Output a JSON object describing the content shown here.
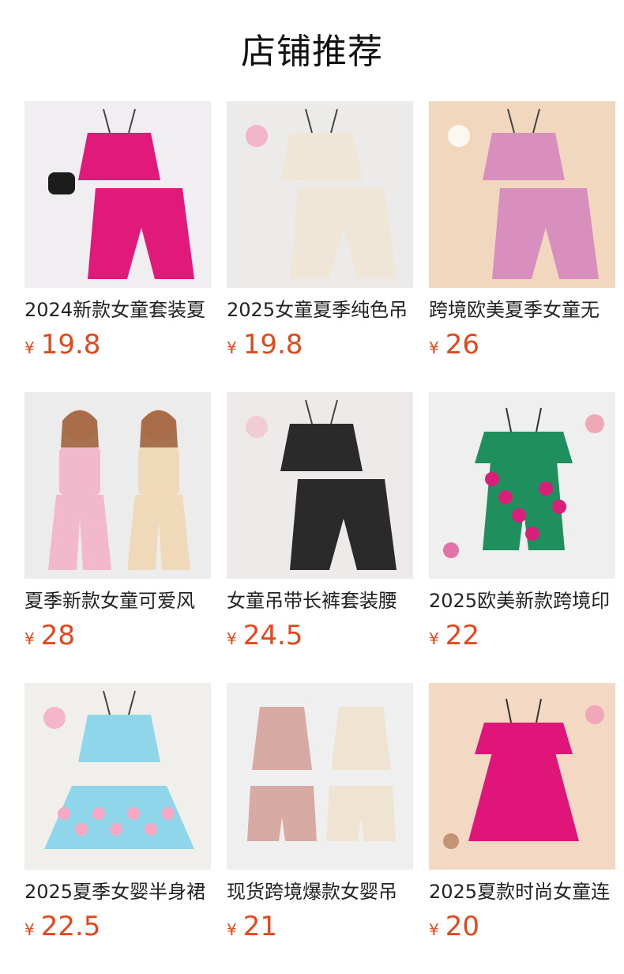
{
  "section": {
    "title": "店铺推荐",
    "currency_symbol": "¥",
    "price_color": "#e4471a"
  },
  "products": [
    {
      "name": "2024新款女童套装夏",
      "price": "19.8",
      "image_icon": "pink-halter-top-and-pants-set-image",
      "bg": "#f1eef2",
      "main": "#e0197a",
      "accent": "#1c1c1c"
    },
    {
      "name": "2025女童夏季纯色吊",
      "price": "19.8",
      "image_icon": "cream-ruffle-cami-and-pants-set-image",
      "bg": "#ecebea",
      "main": "#efe6d8",
      "accent": "#f2a7c3"
    },
    {
      "name": "跨境欧美夏季女童无",
      "price": "26",
      "image_icon": "pink-print-tank-and-pants-set-image",
      "bg": "#f2d7bf",
      "main": "#d98fbe",
      "accent": "#ffffff"
    },
    {
      "name": "夏季新款女童可爱风",
      "price": "28",
      "image_icon": "two-girls-smocked-set-photo-image",
      "bg": "#ececec",
      "main": "#f2b9cc",
      "accent": "#efd9b8"
    },
    {
      "name": "女童吊带长裤套装腰",
      "price": "24.5",
      "image_icon": "black-paisley-cami-and-pants-set-image",
      "bg": "#efeaea",
      "main": "#2a2a2a",
      "accent": "#f3c4cf"
    },
    {
      "name": "2025欧美新款跨境印",
      "price": "22",
      "image_icon": "floral-ruffle-romper-image",
      "bg": "#efefef",
      "main": "#1f8f5e",
      "accent": "#d81f7a"
    },
    {
      "name": "2025夏季女婴半身裙",
      "price": "22.5",
      "image_icon": "floral-crop-top-and-skirt-set-image",
      "bg": "#f1efec",
      "main": "#8fd6ea",
      "accent": "#f6a8c4"
    },
    {
      "name": "现货跨境爆款女婴吊",
      "price": "21",
      "image_icon": "pink-and-cream-ribbed-sets-image",
      "bg": "#efefef",
      "main": "#d8aaa4",
      "accent": "#efe4d2"
    },
    {
      "name": "2025夏款时尚女童连",
      "price": "20",
      "image_icon": "pink-off-shoulder-dress-image",
      "bg": "#f3d9c3",
      "main": "#e0157a",
      "accent": "#a3673f"
    }
  ]
}
